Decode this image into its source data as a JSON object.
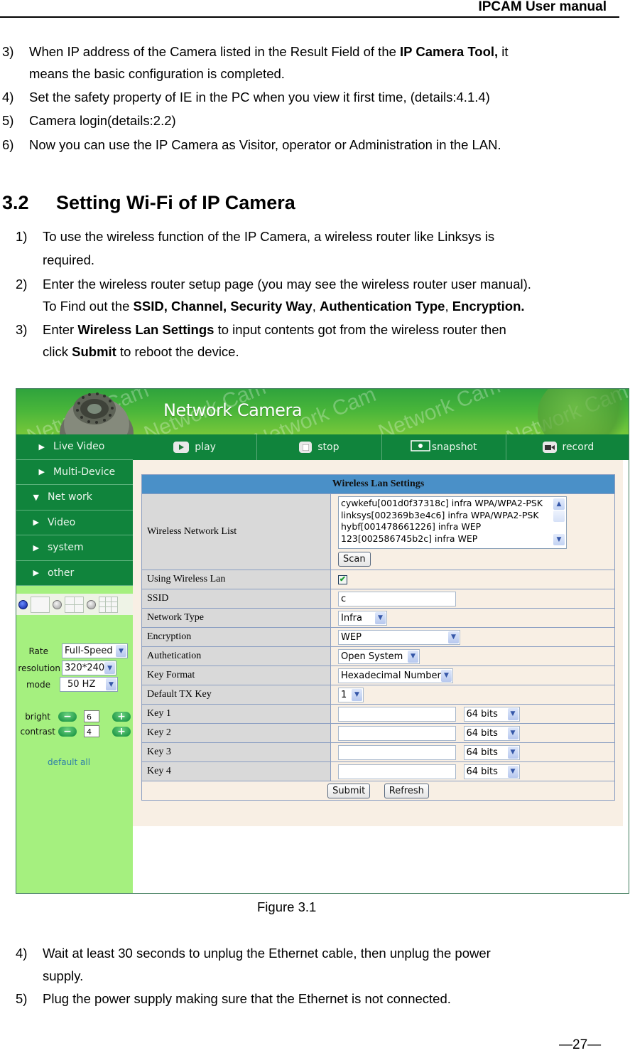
{
  "header": {
    "title": "IPCAM User manual"
  },
  "intro_steps": [
    {
      "num": "3)",
      "parts": [
        {
          "text": "When IP address of the Camera listed in the Result Field of the ",
          "bold": false
        },
        {
          "text": "IP Camera Tool,",
          "bold": true
        },
        {
          "text": " it",
          "bold": false
        }
      ],
      "continuation": "means the basic configuration is completed."
    },
    {
      "num": "4)",
      "text": "Set the safety property of IE in the PC when you view it first time, (details:4.1.4)"
    },
    {
      "num": "5)",
      "text": "Camera login(details:2.2)"
    },
    {
      "num": "6)",
      "text": "Now you can use the IP Camera as Visitor, operator or Administration in the LAN."
    }
  ],
  "section": {
    "number": "3.2",
    "title": "Setting Wi-Fi of IP Camera"
  },
  "wifi_steps": [
    {
      "num": "1)",
      "line1": "To use the wireless function of the IP Camera, a wireless router like Linksys is",
      "line2": "required."
    },
    {
      "num": "2)",
      "line1": "Enter the wireless router setup page (you may see the wireless router user manual).",
      "line2_prefix": "To Find out the ",
      "line2_bold1": "SSID, Channel, Security Way",
      "line2_sep1": ", ",
      "line2_bold2": "Authentication Type",
      "line2_sep2": ", ",
      "line2_bold3": "Encryption."
    },
    {
      "num": "3)",
      "line1_prefix": "Enter ",
      "line1_bold": "Wireless Lan Settings",
      "line1_suffix": " to input contents got from the wireless router then",
      "line2_prefix": "click ",
      "line2_bold": "Submit",
      "line2_suffix": " to reboot the device."
    }
  ],
  "screenshot": {
    "banner_title": "Network Camera",
    "watermark": "Network Cam",
    "toolbar": [
      {
        "label": "play",
        "icon": "play-icon"
      },
      {
        "label": "stop",
        "icon": "stop-icon"
      },
      {
        "label": "snapshot",
        "icon": "snapshot-icon"
      },
      {
        "label": "record",
        "icon": "record-icon"
      }
    ],
    "menu": [
      {
        "label": "Live Video",
        "arrow": "▶"
      },
      {
        "label": "Multi-Device",
        "arrow": "▶"
      },
      {
        "label": "Net work",
        "arrow": "▼"
      },
      {
        "label": "Video",
        "arrow": "▶"
      },
      {
        "label": "system",
        "arrow": "▶"
      },
      {
        "label": "other",
        "arrow": "▶"
      }
    ],
    "controls": {
      "rate_label": "Rate",
      "rate_value": "Full-Speed",
      "resolution_label": "resolution",
      "resolution_value": "320*240",
      "mode_label": "mode",
      "mode_value": "50 HZ",
      "bright_label": "bright",
      "bright_value": "6",
      "contrast_label": "contrast",
      "contrast_value": "4",
      "minus": "−",
      "plus": "+",
      "default_all": "default all"
    },
    "settings": {
      "title": "Wireless Lan Settings",
      "network_list_label": "Wireless Network List",
      "networks": [
        "cywkefu[001d0f37318c] infra WPA/WPA2-PSK",
        "linksys[002369b3e4c6] infra WPA/WPA2-PSK",
        "hybf[001478661226] infra WEP",
        "123[002586745b2c] infra WEP"
      ],
      "scan_label": "Scan",
      "using_wireless_label": "Using Wireless Lan",
      "using_wireless_checked": true,
      "check_mark": "✔",
      "ssid_label": "SSID",
      "ssid_value": "c",
      "network_type_label": "Network Type",
      "network_type_value": "Infra",
      "encryption_label": "Encryption",
      "encryption_value": "WEP",
      "auth_label": "Authetication",
      "auth_value": "Open System",
      "key_format_label": "Key Format",
      "key_format_value": "Hexadecimal Number",
      "default_tx_label": "Default TX Key",
      "default_tx_value": "1",
      "keys": [
        {
          "label": "Key 1",
          "value": "",
          "bits": "64 bits"
        },
        {
          "label": "Key 2",
          "value": "",
          "bits": "64 bits"
        },
        {
          "label": "Key 3",
          "value": "",
          "bits": "64 bits"
        },
        {
          "label": "Key 4",
          "value": "",
          "bits": "64 bits"
        }
      ],
      "submit_label": "Submit",
      "refresh_label": "Refresh",
      "select_arrow": "▼",
      "scroll_up": "▲",
      "scroll_down": "▼"
    }
  },
  "figure_caption": "Figure 3.1",
  "final_steps": [
    {
      "num": "4)",
      "line1": "Wait at least 30 seconds to unplug the Ethernet cable, then unplug the power",
      "line2": "supply."
    },
    {
      "num": "5)",
      "line1": "Plug the power supply making sure that the Ethernet is not connected."
    }
  ],
  "page_number": "—27—"
}
